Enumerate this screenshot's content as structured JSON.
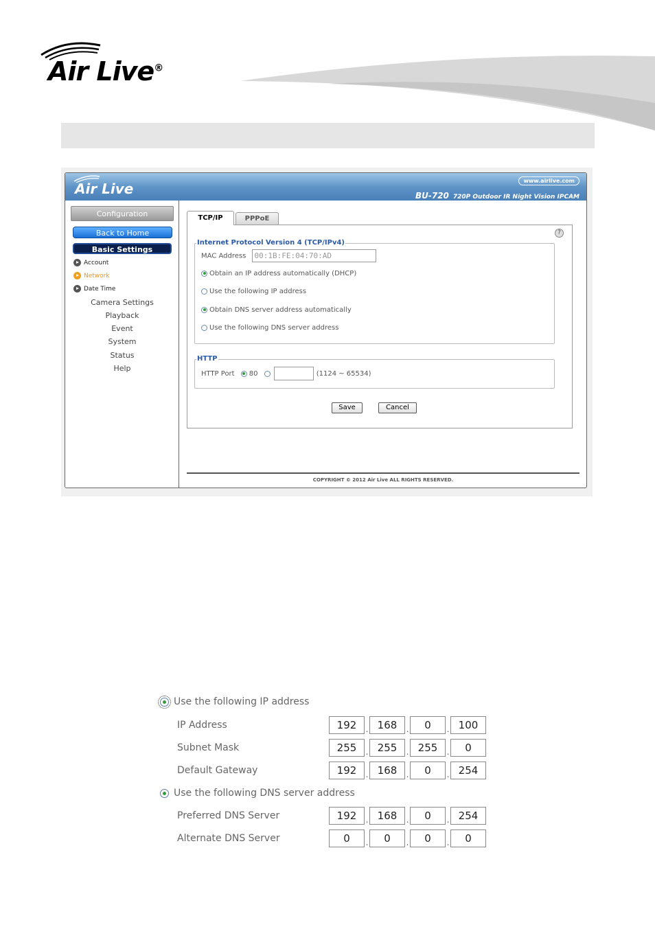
{
  "doc": {
    "logo_text": "Air Live",
    "logo_mark": "®"
  },
  "app": {
    "logo_text": "Air Live",
    "site_link": "www.airlive.com",
    "model": "BU-720",
    "model_desc": "720P Outdoor IR Night Vision IPCAM"
  },
  "sidebar": {
    "configuration": "Configuration",
    "back_home": "Back to Home",
    "basic_settings": "Basic Settings",
    "sub_items": [
      "Account",
      "Network",
      "Date Time"
    ],
    "active_sub": "Network",
    "categories": [
      "Camera Settings",
      "Playback",
      "Event",
      "System",
      "Status",
      "Help"
    ]
  },
  "tabs": [
    "TCP/IP",
    "PPPoE"
  ],
  "ipv4": {
    "legend": "Internet Protocol Version 4 (TCP/IPv4)",
    "mac_label": "MAC Address",
    "mac_value": "00:1B:FE:04:70:AD",
    "options": [
      {
        "label": "Obtain an IP address automatically (DHCP)",
        "selected": true
      },
      {
        "label": "Use the following IP address",
        "selected": false
      },
      {
        "label": "Obtain DNS server address automatically",
        "selected": true
      },
      {
        "label": "Use the following DNS server address",
        "selected": false
      }
    ]
  },
  "http": {
    "legend": "HTTP",
    "port_label": "HTTP Port",
    "default_port": "80",
    "range": "(1124 ~ 65534)"
  },
  "buttons": {
    "save": "Save",
    "cancel": "Cancel"
  },
  "copyright": "COPYRIGHT © 2012 Air Live ALL RIGHTS RESERVED.",
  "detail": {
    "static_ip_option": "Use the following IP address",
    "ip_label": "IP Address",
    "ip": [
      "192",
      "168",
      "0",
      "100"
    ],
    "mask_label": "Subnet Mask",
    "mask": [
      "255",
      "255",
      "255",
      "0"
    ],
    "gateway_label": "Default Gateway",
    "gateway": [
      "192",
      "168",
      "0",
      "254"
    ],
    "dns_option": "Use the following DNS server address",
    "pref_dns_label": "Preferred DNS Server",
    "pref_dns": [
      "192",
      "168",
      "0",
      "254"
    ],
    "alt_dns_label": "Alternate DNS Server",
    "alt_dns": [
      "0",
      "0",
      "0",
      "0"
    ]
  }
}
